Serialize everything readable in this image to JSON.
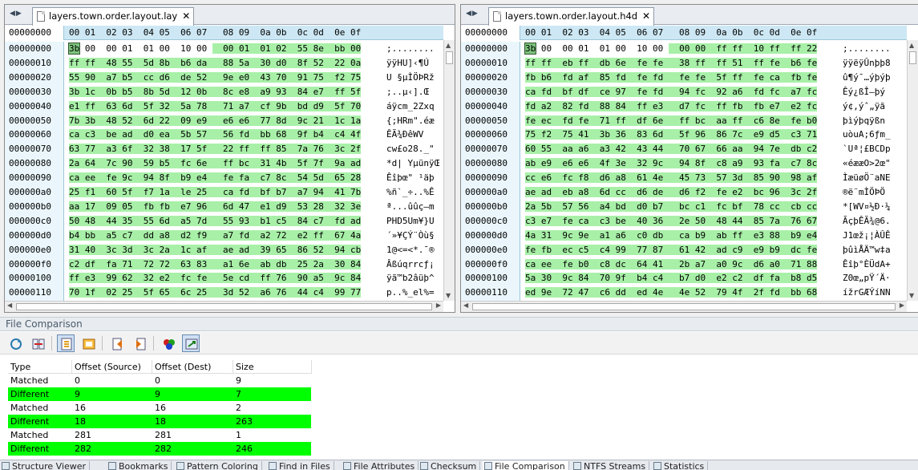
{
  "left_pane": {
    "tab_label": "layers.town.order.layout.lay",
    "header_addr": "00000000",
    "header_cols": "00 01  02 03  04 05  06 07   08 09  0a 0b  0c 0d  0e 0f",
    "rows": [
      {
        "addr": "00000000",
        "hex": "3b 00  00 01  01 00  10 00   00 01  01 02  55 8e  bb 00",
        "text": ";........"
      },
      {
        "addr": "00000010",
        "hex": "ff ff  48 55  5d 8b  b6 da   88 5a  30 d0  8f 52  22 0a",
        "text": "ÿÿHU]‹¶Ú"
      },
      {
        "addr": "00000020",
        "hex": "55 90  a7 b5  cc d6  de 52   9e e0  43 70  91 75  f2 75",
        "text": "U §µÌÖÞRž"
      },
      {
        "addr": "00000030",
        "hex": "3b 1c  0b b5  8b 5d  12 0b   8c e8  a9 93  84 e7  ff 5f",
        "text": ";..µ‹].Œ"
      },
      {
        "addr": "00000040",
        "hex": "e1 ff  63 6d  5f 32  5a 78   71 a7  cf 9b  bd d9  5f 70",
        "text": "áÿcm_2Zxq"
      },
      {
        "addr": "00000050",
        "hex": "7b 3b  48 52  6d 22  09 e9   e6 e6  77 8d  9c 21  1c 1a",
        "text": "{;HRm\".éæ"
      },
      {
        "addr": "00000060",
        "hex": "ca c3  be ad  d0 ea  5b 57   56 fd  bb 68  9f b4  c4 4f",
        "text": "ÊÃ¾­ÐêWV"
      },
      {
        "addr": "00000070",
        "hex": "63 77  a3 6f  32 38  17 5f   22 ff  ff 85  7a 76  3c 2f",
        "text": "cw£o28._\""
      },
      {
        "addr": "00000080",
        "hex": "2a 64  7c 90  59 b5  fc 6e   ff bc  31 4b  5f 7f  9a ad",
        "text": "*d| YµünÿŒ"
      },
      {
        "addr": "00000090",
        "hex": "ca ee  fe 9c  94 8f  b9 e4   fe fa  c7 8c  54 5d  65 28",
        "text": "Êîþœ\" ¹äþ"
      },
      {
        "addr": "000000a0",
        "hex": "25 f1  60 5f  f7 1a  le 25   ca fd  bf b7  a7 94  41 7b",
        "text": "%ñ`_÷..%Ê"
      },
      {
        "addr": "000000b0",
        "hex": "aa 17  09 05  fb fb  e7 96   6d 47  e1 d9  53 28  32 3e",
        "text": "ª...ûûç–m"
      },
      {
        "addr": "000000c0",
        "hex": "50 48  44 35  55 6d  a5 7d   55 93  b1 c5  84 c7  fd ad",
        "text": "PHD5Um¥}U"
      },
      {
        "addr": "000000d0",
        "hex": "b4 bb  a5 c7  dd a8  d2 f9   a7 fd  a2 72  e2 ff  67 4a",
        "text": "´»¥ÇÝ¨Òù§"
      },
      {
        "addr": "000000e0",
        "hex": "31 40  3c 3d  3c 2a  1c af   ae ad  39 65  86 52  94 cb",
        "text": "1@<=<*.¯®"
      },
      {
        "addr": "000000f0",
        "hex": "c2 df  fa 71  72 72  63 83   a1 6e  ab db  25 2a  30 84",
        "text": "Âßúqrrcƒ¡"
      },
      {
        "addr": "00000100",
        "hex": "ff e3  99 62  32 e2  fc fe   5e cd  ff 76  90 a5  9c 84",
        "text": "ÿã™b2âüþ^"
      },
      {
        "addr": "00000110",
        "hex": "70 1f  02 25  5f 65  6c 25   3d 52  a6 76  44 c4  99 77",
        "text": "p..%_el%="
      }
    ]
  },
  "right_pane": {
    "tab_label": "layers.town.order.layout.h4d",
    "header_addr": "00000000",
    "header_cols": "00 01  02 03  04 05  06 07   08 09  0a 0b  0c 0d  0e 0f",
    "rows": [
      {
        "addr": "00000000",
        "hex": "3b 00  00 01  01 00  10 00   00 00  ff ff  10 ff  ff 22",
        "text": ";........"
      },
      {
        "addr": "00000010",
        "hex": "ff ff  eb ff  db 6e  fe fe   38 ff  ff 51  ff fe  b6 fe",
        "text": "ÿÿëÿÛnþþ8"
      },
      {
        "addr": "00000020",
        "hex": "fb b6  fd af  85 fd  fe fd   fe fe  5f ff  fe ca  fb fe",
        "text": "û¶ý¯…ýþýþ"
      },
      {
        "addr": "00000030",
        "hex": "ca fd  bf df  ce 97  fe fd   94 fc  92 a6  fd fc  a7 fc",
        "text": "Êý¿ßÎ—þý"
      },
      {
        "addr": "00000040",
        "hex": "fd a2  82 fd  88 84  ff e3   d7 fc  ff fb  fb e7  e2 fc",
        "text": "ý¢‚ýˆ„ÿã"
      },
      {
        "addr": "00000050",
        "hex": "fe ec  fd fe  71 ff  df 6e   ff bc  aa ff  c6 8e  fe b0",
        "text": "þìýþqÿßn"
      },
      {
        "addr": "00000060",
        "hex": "75 f2  75 41  3b 36  83 6d   5f 96  86 7c  e9 d5  c3 71",
        "text": "uòuA;6ƒm_"
      },
      {
        "addr": "00000070",
        "hex": "60 55  aa a6  a3 42  43 44   70 67  66 aa  94 7e  db c2",
        "text": "`Uª¦£BCDp"
      },
      {
        "addr": "00000080",
        "hex": "ab e9  e6 e6  4f 3e  32 9c   94 8f  c8 a9  93 fa  c7 8c",
        "text": "«éææO>2œ\""
      },
      {
        "addr": "00000090",
        "hex": "cc e6  fc f8  d6 a8  61 4e   45 73  57 3d  85 90  98 af",
        "text": "ÌæüøÖ¨aNE"
      },
      {
        "addr": "000000a0",
        "hex": "ae ad  eb a8  6d cc  d6 de   d6 f2  fe e2  bc 96  3c 2f",
        "text": "®­ë¨mÌÖÞÖ"
      },
      {
        "addr": "000000b0",
        "hex": "2a 5b  57 56  a4 bd  d0 b7   bc c1  fc bf  78 cc  cb cc",
        "text": "*[WV¤½Ð·¼"
      },
      {
        "addr": "000000c0",
        "hex": "c3 e7  fe ca  c3 be  40 36   2e 50  48 44  85 7a  76 67",
        "text": "ÃçþÊÃ¾@6."
      },
      {
        "addr": "000000d0",
        "hex": "4a 31  9c 9e  a1 a6  c0 db   ca b9  ab ff  e3 88  b9 e4",
        "text": "J1œž¡¦ÀÛÊ"
      },
      {
        "addr": "000000e0",
        "hex": "fe fb  ec c5  c4 99  77 87   61 42  ad c9  e9 b9  dc fe",
        "text": "þûìÅÄ™w‡a"
      },
      {
        "addr": "000000f0",
        "hex": "ca ee  fe b0  c8 dc  64 41   2b a7  a0 9c  d6 a0  71 88",
        "text": "Êîþ°ÈÜdA+"
      },
      {
        "addr": "00000100",
        "hex": "5a 30  9c 84  70 9f  b4 c4   b7 d0  e2 c2  df fa  b8 d5",
        "text": "Z0œ„pŸ´Ä·"
      },
      {
        "addr": "00000110",
        "hex": "ed 9e  72 47  c6 dd  ed 4e   4e 52  79 4f  2f fd  bb 68",
        "text": "ížrGÆÝíNN"
      }
    ]
  },
  "comparison": {
    "title": "File Comparison",
    "columns": [
      "Type",
      "Offset (Source)",
      "Offset (Dest)",
      "Size"
    ],
    "rows": [
      {
        "type": "Matched",
        "src": "0",
        "dst": "0",
        "size": "9",
        "diff": false
      },
      {
        "type": "Different",
        "src": "9",
        "dst": "9",
        "size": "7",
        "diff": true
      },
      {
        "type": "Matched",
        "src": "16",
        "dst": "16",
        "size": "2",
        "diff": false
      },
      {
        "type": "Different",
        "src": "18",
        "dst": "18",
        "size": "263",
        "diff": true
      },
      {
        "type": "Matched",
        "src": "281",
        "dst": "281",
        "size": "1",
        "diff": false
      },
      {
        "type": "Different",
        "src": "282",
        "dst": "282",
        "size": "246",
        "diff": true
      }
    ],
    "diff_color": "#00ff00"
  },
  "bottom_tabs": [
    {
      "label": "Structure Viewer",
      "icon": "structure-icon"
    },
    {
      "label": "Bookmarks",
      "icon": "bookmark-icon"
    },
    {
      "label": "Pattern Coloring",
      "icon": "palette-icon"
    },
    {
      "label": "Find in Files",
      "icon": "find-icon"
    },
    {
      "label": "File Attributes",
      "icon": "attributes-icon"
    },
    {
      "label": "Checksum",
      "icon": "checksum-icon"
    },
    {
      "label": "File Comparison",
      "icon": "compare-icon",
      "active": true
    },
    {
      "label": "NTFS Streams",
      "icon": "streams-icon"
    },
    {
      "label": "Statistics",
      "icon": "statistics-icon"
    }
  ]
}
